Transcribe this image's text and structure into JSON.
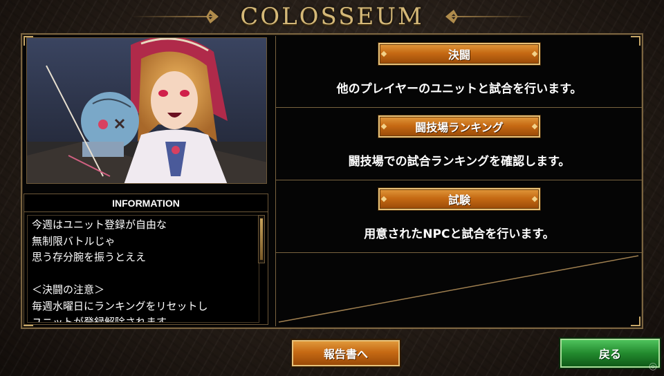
{
  "title": "COLOSSEUM",
  "information": {
    "header": "INFORMATION",
    "lines": [
      "今週はユニット登録が自由な",
      "無制限バトルじゃ",
      "思う存分腕を振うとええ",
      "",
      "＜決闘の注意＞",
      "毎週水曜日にランキングをリセットし",
      "ユニットが登録解除されます"
    ]
  },
  "menu": [
    {
      "label": "決闘",
      "description": "他のプレイヤーのユニットと試合を行います。"
    },
    {
      "label": "闘技場ランキング",
      "description": "闘技場での試合ランキングを確認します。"
    },
    {
      "label": "試験",
      "description": "用意されたNPCと試合を行います。"
    }
  ],
  "buttons": {
    "report": "報告書へ",
    "back": "戻る"
  },
  "colors": {
    "accent_gold": "#c8a868",
    "orange_button": "#c66a14",
    "green_button": "#238a2e"
  }
}
